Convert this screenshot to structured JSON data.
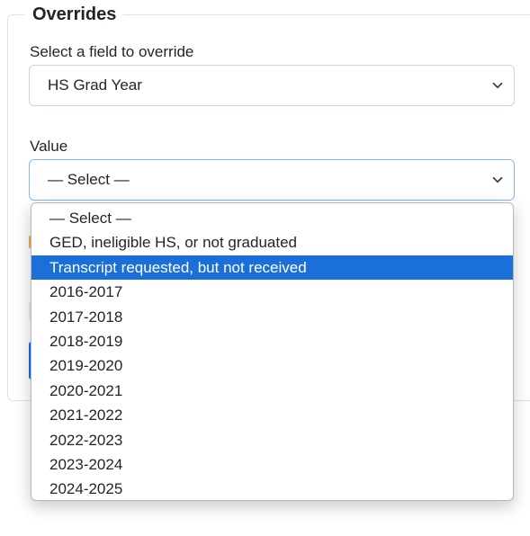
{
  "panel": {
    "legend": "Overrides"
  },
  "field_select": {
    "label": "Select a field to override",
    "value": "HS Grad Year"
  },
  "value_select": {
    "label": "Value",
    "value": "— Select —"
  },
  "dropdown": {
    "options": [
      "— Select —",
      "GED, ineligible HS, or not graduated",
      "Transcript requested, but not received",
      "2016-2017",
      "2017-2018",
      "2018-2019",
      "2019-2020",
      "2020-2021",
      "2021-2022",
      "2022-2023",
      "2023-2024",
      "2024-2025"
    ],
    "highlighted_index": 2
  },
  "colors": {
    "highlight": "#1a6fd8",
    "focus_border": "#86b7fe",
    "primary": "#0d6efd"
  }
}
